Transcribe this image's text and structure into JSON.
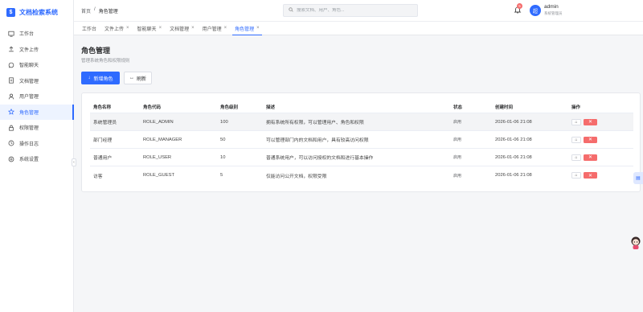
{
  "app": {
    "title": "文档检索系统",
    "logo_glyph": "$"
  },
  "sidebar": {
    "items": [
      {
        "label": "工作台",
        "icon": "desktop-icon"
      },
      {
        "label": "文件上传",
        "icon": "upload-icon"
      },
      {
        "label": "智能聊天",
        "icon": "chat-icon"
      },
      {
        "label": "文档管理",
        "icon": "document-icon"
      },
      {
        "label": "用户管理",
        "icon": "user-icon"
      },
      {
        "label": "角色管理",
        "icon": "star-icon",
        "active": true
      },
      {
        "label": "权限管理",
        "icon": "lock-icon"
      },
      {
        "label": "操作日志",
        "icon": "clock-icon"
      },
      {
        "label": "系统设置",
        "icon": "gear-icon"
      }
    ]
  },
  "header": {
    "breadcrumb": [
      "首页",
      "/",
      "角色管理"
    ],
    "search_placeholder": "搜索文档、用户、角色...",
    "notification_count": "5",
    "avatar_letter": "超",
    "user_name": "admin",
    "user_role": "系统管理员"
  },
  "tabs": [
    {
      "label": "工作台",
      "closable": false
    },
    {
      "label": "文件上传",
      "closable": true
    },
    {
      "label": "智能聊天",
      "closable": true
    },
    {
      "label": "文档管理",
      "closable": true
    },
    {
      "label": "用户管理",
      "closable": true
    },
    {
      "label": "角色管理",
      "closable": true,
      "active": true
    }
  ],
  "page": {
    "title": "角色管理",
    "subtitle": "管理系统角色和权限规则",
    "add_button": "新增角色",
    "refresh_button": "刷新"
  },
  "table": {
    "columns": [
      "角色名称",
      "角色代码",
      "角色级别",
      "描述",
      "状态",
      "创建时间",
      "操作"
    ],
    "rows": [
      {
        "name": "系统管理员",
        "code": "ROLE_ADMIN",
        "level": "100",
        "desc": "拥有系统所有权限，可以管理用户、角色和权限",
        "status": "启用",
        "created": "2026-01-06 21:08"
      },
      {
        "name": "部门经理",
        "code": "ROLE_MANAGER",
        "level": "50",
        "desc": "可以管理部门内的文档和用户，具有较高访问权限",
        "status": "启用",
        "created": "2026-01-06 21:08"
      },
      {
        "name": "普通用户",
        "code": "ROLE_USER",
        "level": "10",
        "desc": "普通系统用户，可以访问授权的文档和进行基本操作",
        "status": "启用",
        "created": "2026-01-06 21:08"
      },
      {
        "name": "访客",
        "code": "ROLE_GUEST",
        "level": "5",
        "desc": "仅能访问公开文档，权限受限",
        "status": "启用",
        "created": "2026-01-06 21:08"
      }
    ],
    "edit_glyph": "⌂",
    "delete_glyph": "✕"
  },
  "colors": {
    "primary": "#2f6bff",
    "danger": "#f56c6c"
  }
}
